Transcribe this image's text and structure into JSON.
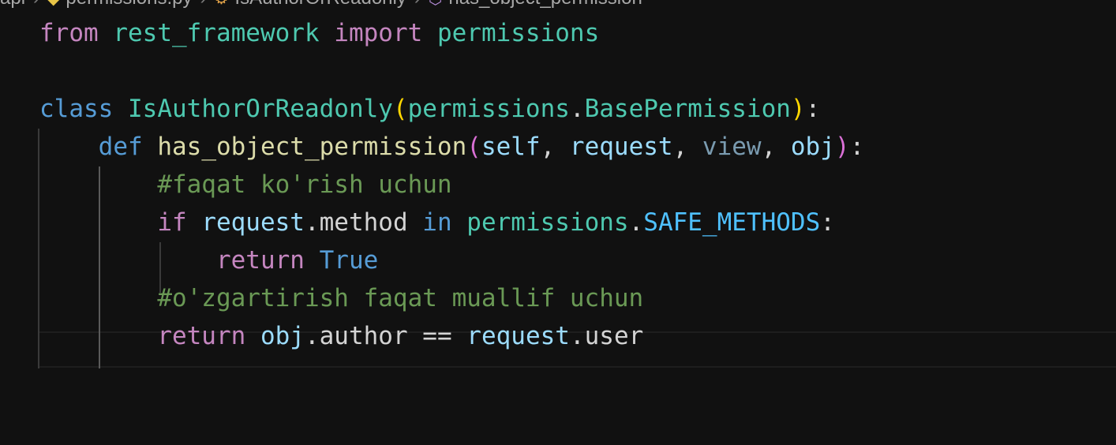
{
  "breadcrumb": {
    "root": "api",
    "file": "permissions.py",
    "class": "IsAuthorOrReadonly",
    "method": "has_object_permission"
  },
  "code": {
    "l1": {
      "from": "from",
      "module": "rest_framework",
      "import": "import",
      "name": "permissions"
    },
    "l3": {
      "class_kw": "class",
      "class_name": "IsAuthorOrReadonly",
      "base_module": "permissions",
      "base_class": "BasePermission"
    },
    "l4": {
      "def_kw": "def",
      "fn_name": "has_object_permission",
      "p1": "self",
      "p2": "request",
      "p3": "view",
      "p4": "obj"
    },
    "l5": {
      "comment": "#faqat ko'rish uchun"
    },
    "l6": {
      "if_kw": "if",
      "obj": "request",
      "attr": "method",
      "in_kw": "in",
      "module": "permissions",
      "const": "SAFE_METHODS"
    },
    "l7": {
      "return_kw": "return",
      "value": "True"
    },
    "l8": {
      "comment": "#o'zgartirish faqat muallif uchun"
    },
    "l9": {
      "return_kw": "return",
      "obj": "obj",
      "attr": "author",
      "op": "==",
      "obj2": "request",
      "attr2": "user"
    }
  }
}
